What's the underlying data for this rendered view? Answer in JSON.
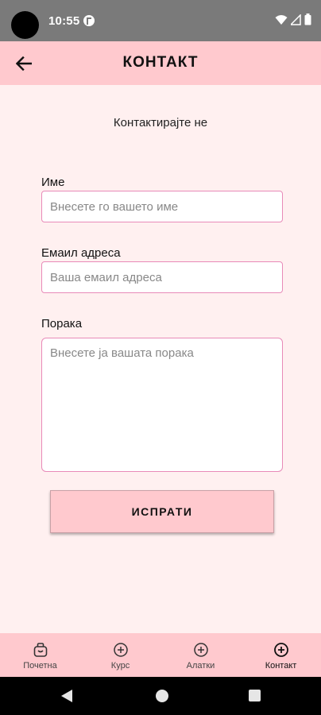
{
  "status_bar": {
    "time": "10:55"
  },
  "app_bar": {
    "title": "КОНТАКТ"
  },
  "form": {
    "subtitle": "Контактирајте не",
    "name": {
      "label": "Име",
      "placeholder": "Внесете го вашето име"
    },
    "email": {
      "label": "Емаил адреса",
      "placeholder": "Ваша емаил адреса"
    },
    "message": {
      "label": "Порака",
      "placeholder": "Внесете ја вашата порака"
    },
    "submit_label": "ИСПРАТИ"
  },
  "bottom_nav": {
    "items": [
      {
        "label": "Почетна",
        "icon": "home-icon"
      },
      {
        "label": "Курс",
        "icon": "add-circle-icon"
      },
      {
        "label": "Алатки",
        "icon": "add-circle-icon"
      },
      {
        "label": "Контакт",
        "icon": "add-circle-icon",
        "active": true
      }
    ]
  },
  "colors": {
    "app_bar": "#ffc9ce",
    "background": "#fff0f0",
    "input_border": "#e88ab8",
    "status_bar": "#7a7a7a"
  }
}
